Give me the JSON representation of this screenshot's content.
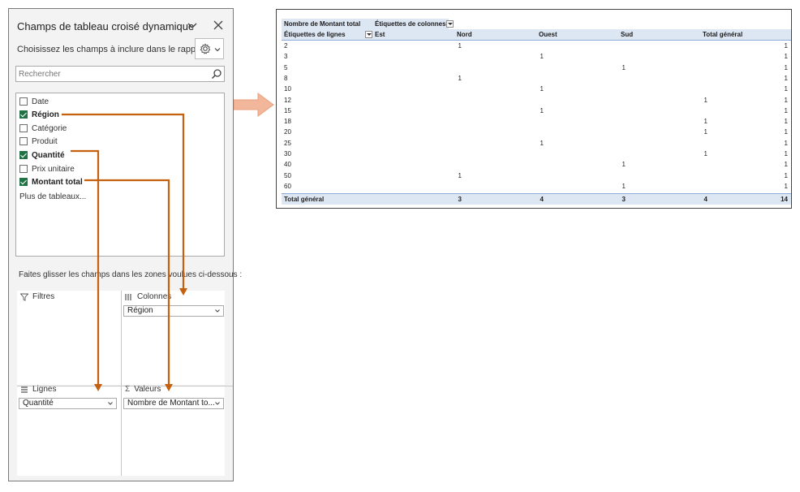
{
  "pane": {
    "title": "Champs de tableau croisé dynamique",
    "choose_label": "Choisissez les champs à inclure dans le rapport :",
    "search_placeholder": "Rechercher",
    "fields": [
      {
        "label": "Date",
        "checked": false
      },
      {
        "label": "Région",
        "checked": true
      },
      {
        "label": "Catégorie",
        "checked": false
      },
      {
        "label": "Produit",
        "checked": false
      },
      {
        "label": "Quantité",
        "checked": true
      },
      {
        "label": "Prix unitaire",
        "checked": false
      },
      {
        "label": "Montant total",
        "checked": true
      }
    ],
    "more_tables": "Plus de tableaux...",
    "drag_hint": "Faites glisser les champs dans les zones voulues ci-dessous :",
    "areas": {
      "filters_label": "Filtres",
      "columns_label": "Colonnes",
      "columns_value": "Région",
      "rows_label": "Lignes",
      "rows_value": "Quantité",
      "values_label": "Valeurs",
      "values_value": "Nombre de Montant to..."
    }
  },
  "pivot": {
    "header_value_label": "Nombre de Montant total",
    "header_col_label": "Étiquettes de colonnes",
    "row_label_header": "Étiquettes de lignes",
    "columns": [
      "Est",
      "Nord",
      "Ouest",
      "Sud",
      "Total général"
    ],
    "rows": [
      {
        "label": "2",
        "cells": [
          "1",
          "",
          "",
          "",
          "1"
        ]
      },
      {
        "label": "3",
        "cells": [
          "",
          "1",
          "",
          "",
          "1"
        ]
      },
      {
        "label": "5",
        "cells": [
          "",
          "",
          "1",
          "",
          "1"
        ]
      },
      {
        "label": "8",
        "cells": [
          "1",
          "",
          "",
          "",
          "1"
        ]
      },
      {
        "label": "10",
        "cells": [
          "",
          "1",
          "",
          "",
          "1"
        ]
      },
      {
        "label": "12",
        "cells": [
          "",
          "",
          "",
          "1",
          "1"
        ]
      },
      {
        "label": "15",
        "cells": [
          "",
          "1",
          "",
          "",
          "1"
        ]
      },
      {
        "label": "18",
        "cells": [
          "",
          "",
          "",
          "1",
          "1"
        ]
      },
      {
        "label": "20",
        "cells": [
          "",
          "",
          "",
          "1",
          "1"
        ]
      },
      {
        "label": "25",
        "cells": [
          "",
          "1",
          "",
          "",
          "1"
        ]
      },
      {
        "label": "30",
        "cells": [
          "",
          "",
          "",
          "1",
          "1"
        ]
      },
      {
        "label": "40",
        "cells": [
          "",
          "",
          "1",
          "",
          "1"
        ]
      },
      {
        "label": "50",
        "cells": [
          "1",
          "",
          "",
          "",
          "1"
        ]
      },
      {
        "label": "60",
        "cells": [
          "",
          "",
          "1",
          "",
          "1"
        ]
      }
    ],
    "total": {
      "label": "Total général",
      "cells": [
        "3",
        "4",
        "3",
        "4",
        "14"
      ]
    }
  },
  "colors": {
    "accent_green": "#217346",
    "connector_orange": "#c5600f",
    "pivot_header_blue": "#dde6f3",
    "big_arrow": "#f2b69a"
  }
}
